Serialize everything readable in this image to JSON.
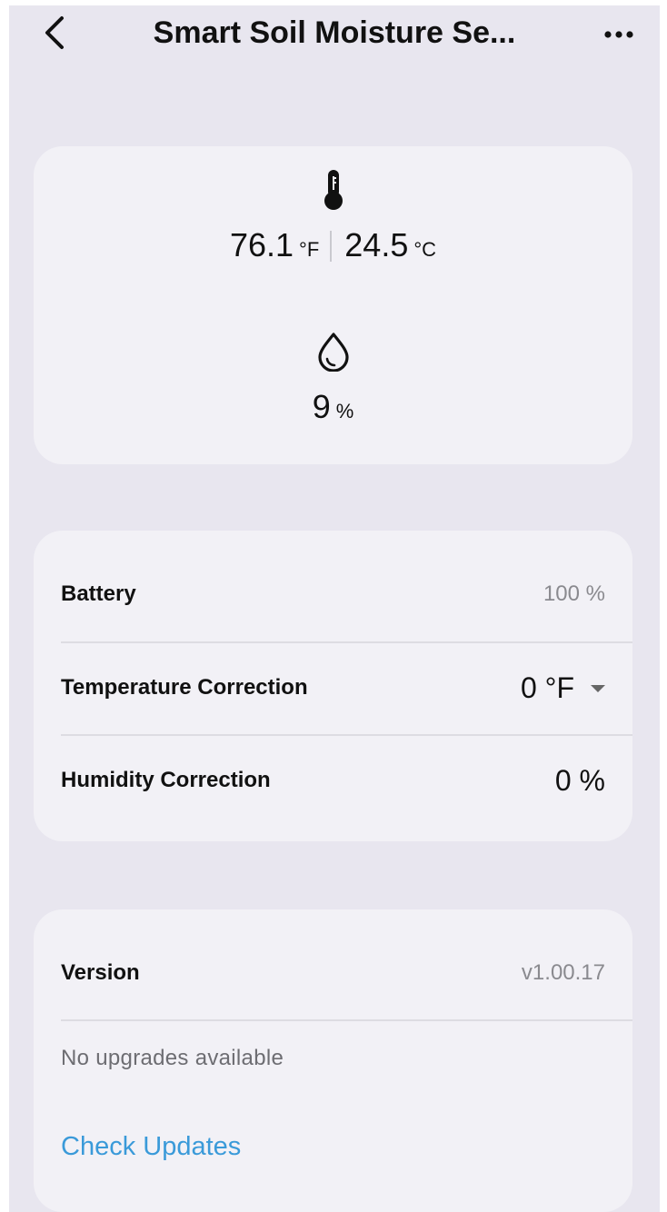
{
  "header": {
    "title": "Smart Soil Moisture Se..."
  },
  "sensor": {
    "temp_f": "76.1",
    "temp_f_unit": "°F",
    "temp_c": "24.5",
    "temp_c_unit": "°C",
    "humidity": "9",
    "humidity_unit": "%"
  },
  "settings": {
    "battery_label": "Battery",
    "battery_value": "100 %",
    "temp_correction_label": "Temperature Correction",
    "temp_correction_value": "0 °F",
    "humidity_correction_label": "Humidity Correction",
    "humidity_correction_value": "0 %"
  },
  "version": {
    "label": "Version",
    "value": "v1.00.17",
    "status": "No upgrades available",
    "check_updates": "Check Updates"
  },
  "icons": {
    "back": "chevron-left-icon",
    "more": "more-horizontal-icon",
    "temperature": "thermometer-icon",
    "humidity": "water-drop-icon",
    "dropdown": "caret-down-icon"
  },
  "colors": {
    "background": "#e8e6ef",
    "card": "#f2f1f6",
    "link": "#3a9ad9"
  }
}
